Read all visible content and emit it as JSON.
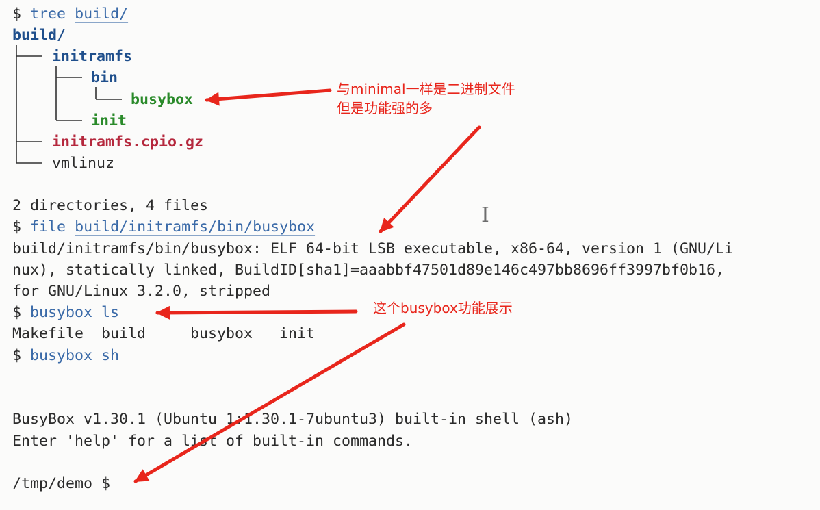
{
  "terminal": {
    "prompt": "$",
    "tree_cmd": {
      "cmd": "tree",
      "arg": "build/"
    },
    "tree": {
      "root": "build/",
      "initramfs": "initramfs",
      "bin": "bin",
      "busybox": "busybox",
      "init": "init",
      "cpio": "initramfs.cpio.gz",
      "vmlinuz": "vmlinuz"
    },
    "summary": "2 directories, 4 files",
    "file_cmd": {
      "cmd": "file",
      "arg": "build/initramfs/bin/busybox"
    },
    "file_out": [
      "build/initramfs/bin/busybox: ELF 64-bit LSB executable, x86-64, version 1 (GNU/Li",
      "nux), statically linked, BuildID[sha1]=aaabbf47501d89e146c497bb8696ff3997bf0b16,",
      "for GNU/Linux 3.2.0, stripped"
    ],
    "ls_cmd": "busybox ls",
    "ls_out": "Makefile  build     busybox   init",
    "sh_cmd": "busybox sh",
    "busybox_banner": "BusyBox v1.30.1 (Ubuntu 1:1.30.1-7ubuntu3) built-in shell (ash)",
    "help_line": "Enter 'help' for a list of built-in commands.",
    "shell_prompt": "/tmp/demo $"
  },
  "annotations": {
    "note1_line1": "与minimal一样是二进制文件",
    "note1_line2": "但是功能强的多",
    "note2": "这个busybox功能展示",
    "color": "#e8261c"
  },
  "cursor_icon": "text-cursor-icon"
}
